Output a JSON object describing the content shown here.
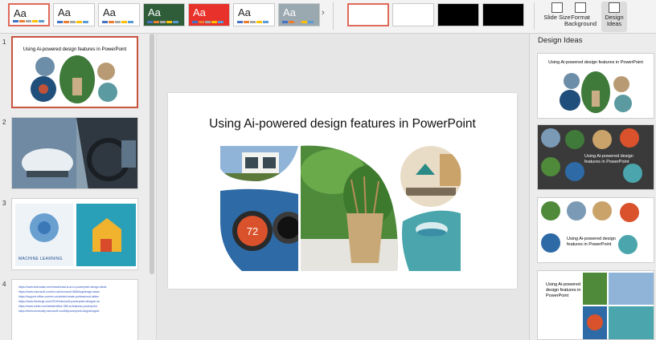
{
  "ribbon": {
    "themes": [
      {
        "label": "Aa",
        "bg": "#ffffff",
        "fg": "#222222",
        "selected": true
      },
      {
        "label": "Aa",
        "bg": "#ffffff",
        "fg": "#222222",
        "selected": false
      },
      {
        "label": "Aa",
        "bg": "#ffffff",
        "fg": "#222222",
        "selected": false
      },
      {
        "label": "Aa",
        "bg": "#2f5d3a",
        "fg": "#ffffff",
        "selected": false
      },
      {
        "label": "Aa",
        "bg": "#e8312a",
        "fg": "#ffffff",
        "selected": false
      },
      {
        "label": "Aa",
        "bg": "#ffffff",
        "fg": "#222222",
        "selected": false
      },
      {
        "label": "Aa",
        "bg": "#9aa8b0",
        "fg": "#ffffff",
        "selected": false
      }
    ],
    "variants": [
      "#ffffff",
      "#ffffff",
      "#000000",
      "#000000"
    ],
    "slide_size_label": "Slide Size",
    "format_background_label": "Format Background",
    "design_ideas_label": "Design Ideas"
  },
  "thumbnails": {
    "numbers": [
      "1",
      "2",
      "3",
      "4"
    ],
    "slide1_title": "Using Ai-powered design  features in PowerPoint",
    "slide3_caption": "MACHINE LEARNING",
    "slide4_links": [
      "https://www.techradar.com/news/what-is-ai-in-powerpoint-design-ideas",
      "https://www.microsoft.com/en-us/microsoft-365/blog/design-ideas",
      "https://support.office.com/en-us/article/create-professional-slides",
      "https://www.theverge.com/2019/microsoft-powerpoint-designer-ai",
      "https://www.zdnet.com/article/office-365-ai-features-powerpoint",
      "https://techcommunity.microsoft.com/t5/powerpoint-blog/designer"
    ]
  },
  "slide": {
    "title": "Using Ai-powered design  features in PowerPoint",
    "thermostat_reading": "72"
  },
  "design_ideas": {
    "header": "Design Ideas",
    "idea1_title": "Using Ai-powered design  features in PowerPoint",
    "idea2_title": "Using Ai-powered design features in PowerPoint",
    "idea3_title": "Using Ai-powered design features in PowerPoint",
    "idea4_title": "Using Ai-powered design features in PowerPoint"
  }
}
